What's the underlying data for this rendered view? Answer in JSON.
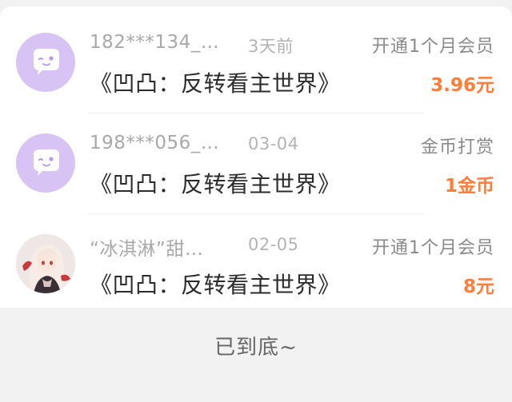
{
  "records": [
    {
      "user_name": "182***134_…",
      "time": "3天前",
      "action": "开通1个月会员",
      "book_title": "《凹凸：反转看主世界》",
      "amount": "3.96元",
      "avatar": "default-chat-avatar-icon"
    },
    {
      "user_name": "198***056_…",
      "time": "03-04",
      "action": "金币打赏",
      "book_title": "《凹凸：反转看主世界》",
      "amount": "1金币",
      "avatar": "default-chat-avatar-icon"
    },
    {
      "user_name": "“冰淇淋”甜…",
      "time": "02-05",
      "action": "开通1个月会员",
      "book_title": "《凹凸：反转看主世界》",
      "amount": "8元",
      "avatar": "anime-girl-avatar"
    }
  ],
  "footer": {
    "end_text": "已到底~"
  },
  "colors": {
    "accent": "#ff7d38",
    "avatar_default_bg": "#d7c4f5",
    "page_bg": "#f2f2f2"
  }
}
